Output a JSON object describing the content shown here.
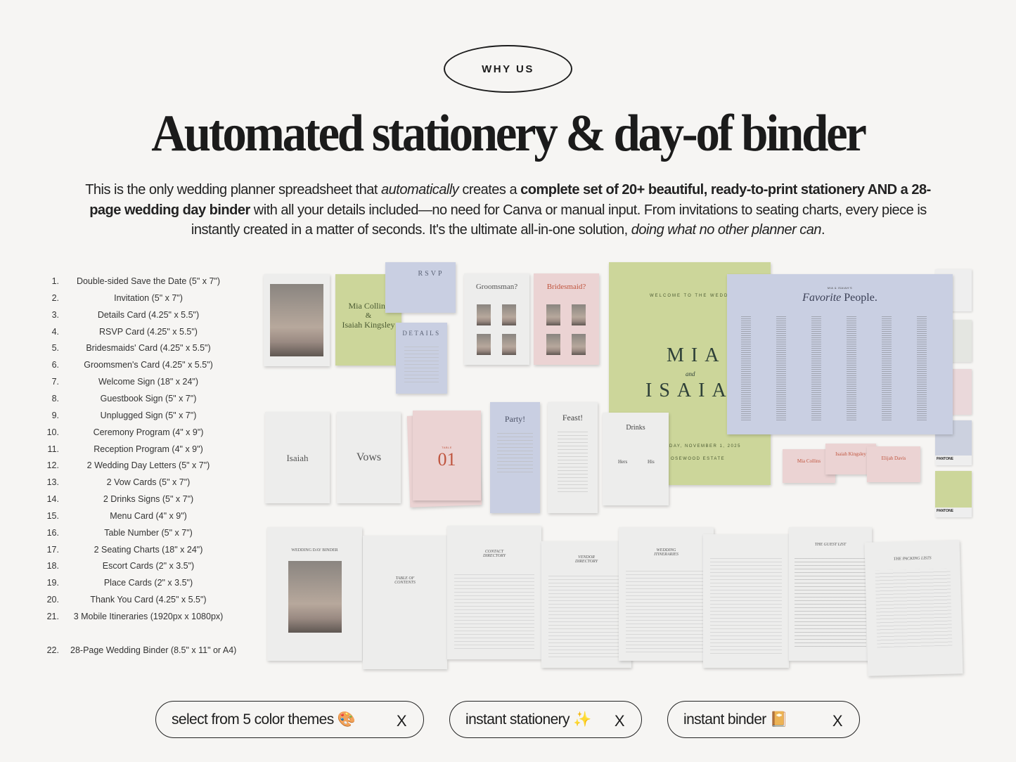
{
  "badge": "WHY US",
  "title": "Automated stationery & day-of binder",
  "intro": {
    "p1": "This is the only wedding planner spreadsheet that ",
    "p1_italic": "automatically",
    "p2": " creates a ",
    "p2_bold": "complete set of 20+ beautiful, ready-to-print stationery AND a 28-page wedding day binder",
    "p3": " with all your details included—no need for Canva or manual input. From invitations to seating charts, every piece is instantly created in a matter of seconds. It's the ultimate all-in-one solution, ",
    "p3_italic": "doing what no other planner can",
    "p4": "."
  },
  "items": [
    {
      "n": "1.",
      "t": "Double-sided Save the Date (5\" x 7\")"
    },
    {
      "n": "2.",
      "t": "Invitation (5\" x 7\")"
    },
    {
      "n": "3.",
      "t": "Details Card (4.25\" x 5.5\")"
    },
    {
      "n": "4.",
      "t": "RSVP Card (4.25\" x 5.5\")"
    },
    {
      "n": "5.",
      "t": "Bridesmaids' Card (4.25\" x 5.5\")"
    },
    {
      "n": "6.",
      "t": "Groomsmen's Card (4.25\" x 5.5\")"
    },
    {
      "n": "7.",
      "t": "Welcome Sign (18\" x 24\")"
    },
    {
      "n": "8.",
      "t": "Guestbook Sign (5\" x 7\")"
    },
    {
      "n": "9.",
      "t": "Unplugged Sign (5\" x 7\")"
    },
    {
      "n": "10.",
      "t": "Ceremony Program (4\" x 9\")"
    },
    {
      "n": "11.",
      "t": "Reception Program (4\" x 9\")"
    },
    {
      "n": "12.",
      "t": "2 Wedding Day Letters (5\" x 7\")"
    },
    {
      "n": "13.",
      "t": "2 Vow Cards (5\" x 7\")"
    },
    {
      "n": "14.",
      "t": "2 Drinks Signs (5\" x 7\")"
    },
    {
      "n": "15.",
      "t": "Menu Card (4\" x 9\")"
    },
    {
      "n": "16.",
      "t": "Table Number (5\" x 7\")"
    },
    {
      "n": "17.",
      "t": "2 Seating Charts (18\" x 24\")"
    },
    {
      "n": "18.",
      "t": "Escort Cards (2\" x 3.5\")"
    },
    {
      "n": "19.",
      "t": "Place Cards (2\" x 3.5\")"
    },
    {
      "n": "20.",
      "t": "Thank You Card (4.25\" x 5.5\")"
    },
    {
      "n": "21.",
      "t": "3 Mobile Itineraries (1920px x 1080px)"
    },
    {
      "n": "22.",
      "t": "28-Page Wedding Binder (8.5\" x 11\" or A4)"
    }
  ],
  "stationery": {
    "invite_name1": "Mia Collins",
    "invite_amp": "&",
    "invite_name2": "Isaiah Kingsley",
    "rsvp": "RSVP",
    "details": "DETAILS",
    "groomsman": "Groomsman?",
    "bridesmaid": "Bridesmaid?",
    "welcome_top": "WELCOME TO THE WEDDING O",
    "welcome_mia": "MIA",
    "welcome_and": "and",
    "welcome_isaiah": "ISAIAH",
    "welcome_date": "DAY, NOVEMBER 1, 2025",
    "welcome_venue": "OSEWOOD ESTATE",
    "seating_kicker": "MIA & ISAIAH'S",
    "seating_title_italic": "Favorite",
    "seating_title": " People.",
    "letter": "Isaiah",
    "vows": "Vows",
    "table_label": "TABLE",
    "table_number": "01",
    "party": "Party!",
    "feast": "Feast!",
    "drinks": "Drinks",
    "hers": "Hers",
    "his": "His",
    "escort": [
      "Mia Collins",
      "Isaiah Kingsley",
      "Elijah Davis"
    ],
    "pantone": "PANTONE"
  },
  "binder": {
    "cover": "WEDDING DAY BINDER",
    "toc": "TABLE OF CONTENTS",
    "contact": "CONTACT DIRECTORY",
    "vendor": "VENDOR DIRECTORY",
    "itin": "WEDDING ITINERARIES",
    "guest": "THE GUEST LIST",
    "packing": "THE PACKING LISTS"
  },
  "pills": [
    {
      "label": "select from 5 color themes 🎨",
      "close": "X"
    },
    {
      "label": "instant stationery ✨",
      "close": "X"
    },
    {
      "label": "instant binder 📔",
      "close": "X"
    }
  ],
  "colors": {
    "sage": "#ccd69a",
    "blue": "#c9cfe2",
    "blush": "#ebd3d3",
    "paper": "#ededec",
    "accent_red": "#c0553f"
  }
}
